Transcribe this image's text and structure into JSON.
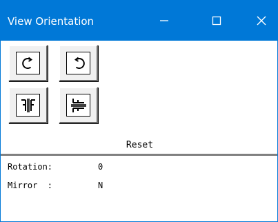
{
  "window": {
    "title": "View Orientation",
    "titlebar_color": "#0078d7",
    "controls": {
      "minimize_icon": "minimize-icon",
      "maximize_icon": "maximize-icon",
      "close_icon": "close-icon"
    }
  },
  "toolbar": {
    "buttons": [
      {
        "name": "rotate-left",
        "icon": "rotate-left-icon"
      },
      {
        "name": "rotate-right",
        "icon": "rotate-right-icon"
      },
      {
        "name": "mirror-horizontal",
        "icon": "mirror-horizontal-icon"
      },
      {
        "name": "mirror-vertical",
        "icon": "mirror-vertical-icon"
      }
    ]
  },
  "reset_label": "Reset",
  "status": {
    "rotation_label": "Rotation:",
    "rotation_value": "0",
    "mirror_label": "Mirror  :",
    "mirror_value": "N"
  }
}
